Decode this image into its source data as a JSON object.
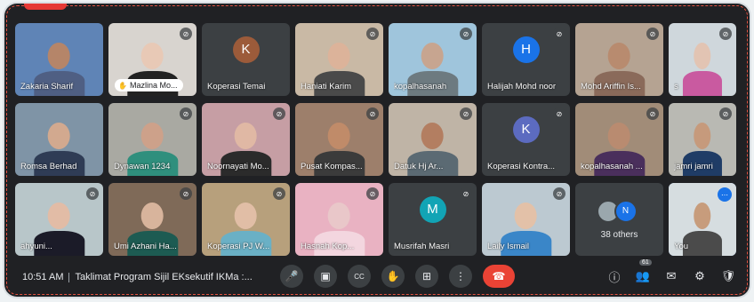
{
  "meeting": {
    "time": "10:51 AM",
    "title": "Taklimat Program Sijil EKsekutif IKMa :...",
    "participants_count": "61"
  },
  "tiles": [
    {
      "name": "Zakaria Sharif",
      "type": "video",
      "bg": "#5f84b6",
      "skin": "#b58569",
      "cloth": "#4f5f83",
      "mic": "none"
    },
    {
      "name": "Mazlina Mo...",
      "type": "video-pill",
      "bg": "#d8d4cf",
      "skin": "#e8c9b6",
      "cloth": "#222",
      "mic": "off"
    },
    {
      "name": "Koperasi Temai",
      "type": "avatar",
      "initial": "K",
      "avatar": "#9c5b3a",
      "mic": "none"
    },
    {
      "name": "Haniati Karim",
      "type": "video",
      "bg": "#c9b9a5",
      "skin": "#dcb39a",
      "cloth": "#4a4a4a",
      "mic": "off"
    },
    {
      "name": "kopalhasanah",
      "type": "video",
      "bg": "#9fc5dc",
      "skin": "#c7a590",
      "cloth": "#6d7a80",
      "mic": "off"
    },
    {
      "name": "Halijah Mohd noor",
      "type": "avatar",
      "initial": "H",
      "avatar": "#1a73e8",
      "mic": "off"
    },
    {
      "name": "Mohd Ariffin Is...",
      "type": "video",
      "bg": "#b5a392",
      "skin": "#b88b6f",
      "cloth": "#8a6a5a",
      "mic": "off"
    },
    {
      "name": "s",
      "type": "video",
      "bg": "#cfd7dc",
      "skin": "#e2c4b3",
      "cloth": "#c95aa0",
      "mic": "off"
    },
    {
      "name": "Romsa Berhad",
      "type": "video",
      "bg": "#7f94a6",
      "skin": "#d2a98f",
      "cloth": "#2f3c55",
      "mic": "none"
    },
    {
      "name": "Dynawan 1234",
      "type": "video",
      "bg": "#a9a9a2",
      "skin": "#cda18a",
      "cloth": "#2f8f7d",
      "mic": "off"
    },
    {
      "name": "Noornayati Mo...",
      "type": "video",
      "bg": "#c69ea4",
      "skin": "#e0b8a4",
      "cloth": "#2b2b2b",
      "mic": "off"
    },
    {
      "name": "Pusat Kompas...",
      "type": "video",
      "bg": "#9d7f6b",
      "skin": "#c08b69",
      "cloth": "#3b3b3b",
      "mic": "off"
    },
    {
      "name": "Datuk Hj Ar...",
      "type": "video",
      "bg": "#bfb4a6",
      "skin": "#b37e61",
      "cloth": "#5b6a73",
      "mic": "off"
    },
    {
      "name": "Koperasi Kontra...",
      "type": "avatar",
      "initial": "K",
      "avatar": "#5c6bc0",
      "mic": "off"
    },
    {
      "name": "kopalhasanah ...",
      "type": "video",
      "bg": "#a18c78",
      "skin": "#b98b70",
      "cloth": "#4a2f5c",
      "mic": "off"
    },
    {
      "name": "jamri jamri",
      "type": "video",
      "bg": "#b9b9b3",
      "skin": "#c69a7c",
      "cloth": "#1f3c66",
      "mic": "off"
    },
    {
      "name": "ahyuni...",
      "type": "video",
      "bg": "#b8c6c9",
      "skin": "#e2bca6",
      "cloth": "#1b1b28",
      "mic": "off"
    },
    {
      "name": "Umi Azhani Ha...",
      "type": "video",
      "bg": "#7f6a58",
      "skin": "#d8b49c",
      "cloth": "#1d5b52",
      "mic": "off"
    },
    {
      "name": "Koperasi PJ W...",
      "type": "video",
      "bg": "#b7a07c",
      "skin": "#e1bea6",
      "cloth": "#6ab0c5",
      "mic": "off"
    },
    {
      "name": "Hasnah Kop...",
      "type": "video",
      "bg": "#e9b2c2",
      "skin": "#e9c7c9",
      "cloth": "#f3d6df",
      "mic": "off"
    },
    {
      "name": "Musrifah Masri",
      "type": "avatar",
      "initial": "M",
      "avatar": "#12a4b5",
      "mic": "off"
    },
    {
      "name": "Laily Ismail",
      "type": "video",
      "bg": "#bcc9d1",
      "skin": "#e3c1a8",
      "cloth": "#3a86c8",
      "mic": "off"
    },
    {
      "name": "38 others",
      "type": "others",
      "initial": "N",
      "avatar": "#1a73e8",
      "mic": "none"
    },
    {
      "name": "You",
      "type": "video",
      "bg": "#d6dde0",
      "skin": "#c79c7c",
      "cloth": "#4b4b4b",
      "mic": "speaking",
      "self": true
    }
  ],
  "controls": [
    {
      "name": "mic-button",
      "icon": "🎤"
    },
    {
      "name": "camera-button",
      "icon": "▣"
    },
    {
      "name": "captions-button",
      "icon": "CC"
    },
    {
      "name": "raise-hand-button",
      "icon": "✋"
    },
    {
      "name": "present-button",
      "icon": "⊞"
    },
    {
      "name": "more-options-button",
      "icon": "⋮"
    },
    {
      "name": "leave-call-button",
      "icon": "☎",
      "end": true
    }
  ],
  "right_icons": [
    {
      "name": "info-icon",
      "icon": "ⓘ"
    },
    {
      "name": "people-icon",
      "icon": "👥"
    },
    {
      "name": "chat-icon",
      "icon": "✉"
    },
    {
      "name": "activities-icon",
      "icon": "⚙"
    },
    {
      "name": "host-controls-icon",
      "icon": "🛡"
    }
  ]
}
